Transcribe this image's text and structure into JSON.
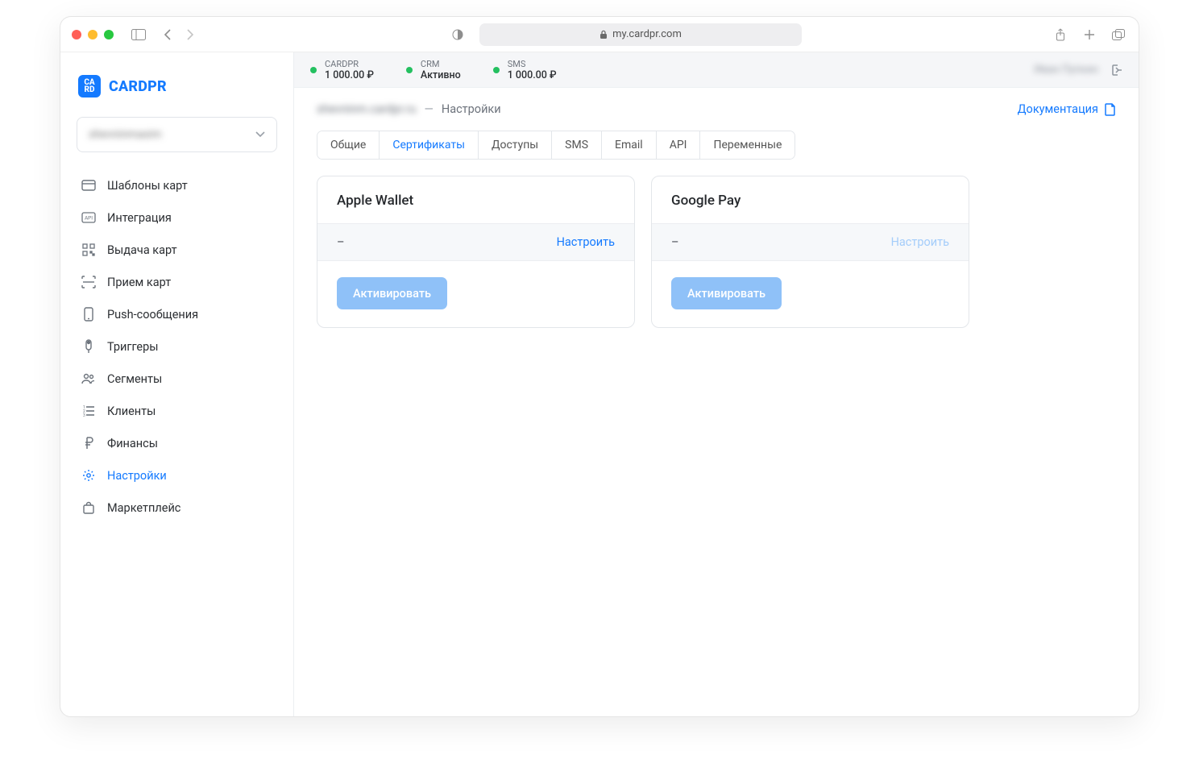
{
  "browser": {
    "url_host": "my.cardpr.com"
  },
  "brand": {
    "name": "CARDPR",
    "logo_text": "CA\nRD"
  },
  "workspace": {
    "selected": "shevninmaxim"
  },
  "sidebar": {
    "items": [
      {
        "label": "Шаблоны карт"
      },
      {
        "label": "Интеграция"
      },
      {
        "label": "Выдача карт"
      },
      {
        "label": "Прием карт"
      },
      {
        "label": "Push-сообщения"
      },
      {
        "label": "Триггеры"
      },
      {
        "label": "Сегменты"
      },
      {
        "label": "Клиенты"
      },
      {
        "label": "Финансы"
      },
      {
        "label": "Настройки"
      },
      {
        "label": "Маркетплейс"
      }
    ]
  },
  "status_bar": {
    "items": [
      {
        "label": "CARDPR",
        "value": "1 000.00 ₽"
      },
      {
        "label": "CRM",
        "value": "Активно"
      },
      {
        "label": "SMS",
        "value": "1 000.00 ₽"
      }
    ],
    "account_name": "Иван Пупкин"
  },
  "breadcrumb": {
    "site": "shevninm.cardpr.ru",
    "sep": "—",
    "current": "Настройки"
  },
  "doc_link": "Документация",
  "tabs": [
    {
      "label": "Общие"
    },
    {
      "label": "Сертификаты"
    },
    {
      "label": "Доступы"
    },
    {
      "label": "SMS"
    },
    {
      "label": "Email"
    },
    {
      "label": "API"
    },
    {
      "label": "Переменные"
    }
  ],
  "cards": {
    "apple": {
      "title": "Apple Wallet",
      "value": "–",
      "configure": "Настроить",
      "action": "Активировать"
    },
    "google": {
      "title": "Google Pay",
      "value": "–",
      "configure": "Настроить",
      "action": "Активировать"
    }
  }
}
